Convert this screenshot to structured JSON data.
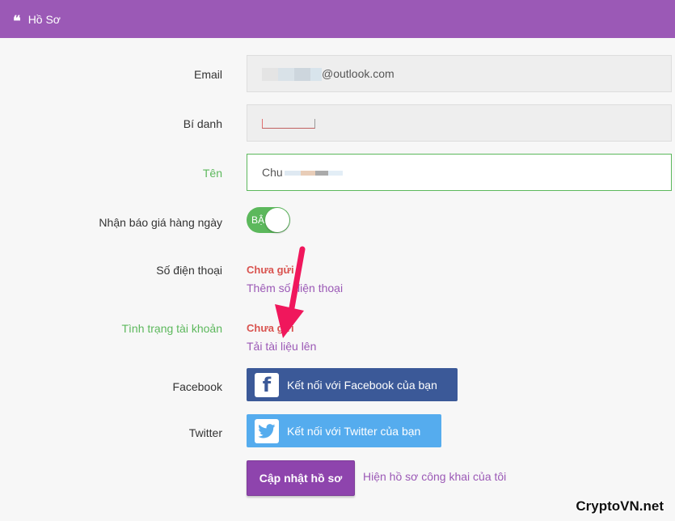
{
  "header": {
    "icon": "quote-icon",
    "title": "Hồ Sơ"
  },
  "colors": {
    "header": "#9b59b6",
    "green": "#5cb85c",
    "red": "#d9534f",
    "facebook": "#3b5998",
    "twitter": "#55acee"
  },
  "form": {
    "email_label": "Email",
    "email_value": "@outlook.com",
    "alias_label": "Bí danh",
    "name_label": "Tên",
    "name_value": "Chu",
    "daily_quote_label": "Nhận báo giá hàng ngày",
    "toggle_text": "BẬ",
    "toggle_on": true,
    "phone_label": "Số điện thoại",
    "phone_status": "Chưa gửi",
    "phone_link": "Thêm số điện thoại",
    "account_status_label": "Tình trạng tài khoản",
    "account_status": "Chưa gửi",
    "account_link": "Tải tài liệu lên",
    "facebook_label": "Facebook",
    "facebook_button": "Kết nối với Facebook của bạn",
    "twitter_label": "Twitter",
    "twitter_button": "Kết nối với Twitter của bạn",
    "update_button": "Cập nhật hồ sơ",
    "public_link": "Hiện hồ sơ công khai của tôi"
  },
  "watermark": "CryptoVN.net"
}
